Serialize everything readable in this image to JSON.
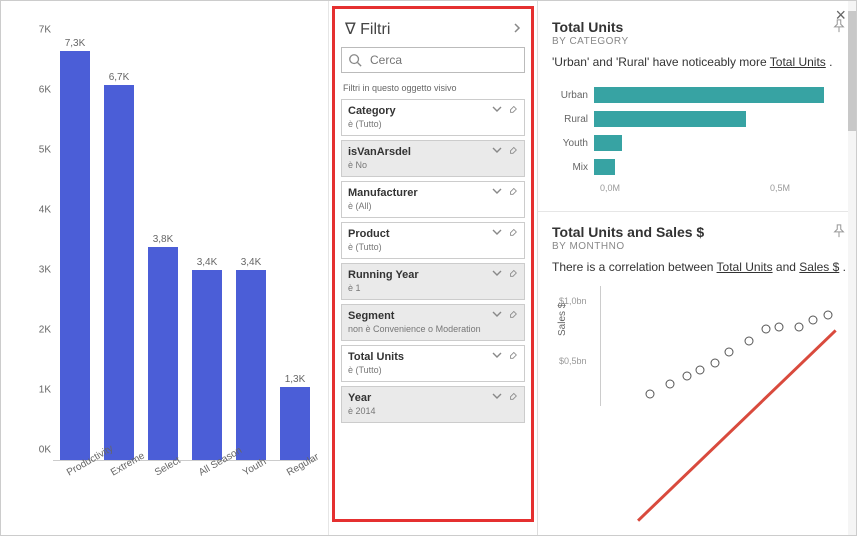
{
  "filters": {
    "header": "Filtri",
    "search_placeholder": "Cerca",
    "section_title": "Filtri in questo oggetto visivo",
    "cards": [
      {
        "name": "Category",
        "desc": "è (Tutto)",
        "active": false
      },
      {
        "name": "isVanArsdel",
        "desc": "è No",
        "active": true
      },
      {
        "name": "Manufacturer",
        "desc": "è (All)",
        "active": false
      },
      {
        "name": "Product",
        "desc": "è (Tutto)",
        "active": false
      },
      {
        "name": "Running Year",
        "desc": "è 1",
        "active": true
      },
      {
        "name": "Segment",
        "desc": "non è Convenience o Moderation",
        "active": true
      },
      {
        "name": "Total Units",
        "desc": "è (Tutto)",
        "active": false
      },
      {
        "name": "Year",
        "desc": "è 2014",
        "active": true
      }
    ]
  },
  "chart_data": [
    {
      "type": "bar",
      "orientation": "vertical",
      "title": "",
      "ylabel": "",
      "ylim": [
        0,
        7500
      ],
      "y_ticks": [
        "0K",
        "1K",
        "2K",
        "3K",
        "4K",
        "5K",
        "6K",
        "7K"
      ],
      "categories": [
        "Productivity",
        "Extreme",
        "Select",
        "All Season",
        "Youth",
        "Regular"
      ],
      "values": [
        7300,
        6700,
        3800,
        3400,
        3400,
        1300
      ],
      "value_labels": [
        "7,3K",
        "6,7K",
        "3,8K",
        "3,4K",
        "3,4K",
        "1,3K"
      ],
      "bar_color": "#4b5ed7"
    },
    {
      "type": "bar",
      "orientation": "horizontal",
      "title": "Total Units",
      "subtitle": "BY CATEGORY",
      "description": "'Urban' and 'Rural' have noticeably more Total Units .",
      "categories": [
        "Urban",
        "Rural",
        "Youth",
        "Mix"
      ],
      "values": [
        500000,
        330000,
        60000,
        45000
      ],
      "x_ticks": [
        "0,0M",
        "0,5M"
      ],
      "bar_color": "#37a3a3"
    },
    {
      "type": "scatter",
      "title": "Total Units and Sales $",
      "subtitle": "BY MONTHNO",
      "description_parts": [
        "There is a correlation between ",
        "Total Units",
        " and ",
        "Sales $"
      ],
      "ylabel": "Sales $",
      "y_ticks": [
        "$1,0bn",
        "$0,5bn"
      ],
      "points": [
        {
          "x": 0.2,
          "y": 0.9
        },
        {
          "x": 0.28,
          "y": 0.82
        },
        {
          "x": 0.35,
          "y": 0.75
        },
        {
          "x": 0.4,
          "y": 0.7
        },
        {
          "x": 0.46,
          "y": 0.64
        },
        {
          "x": 0.52,
          "y": 0.55
        },
        {
          "x": 0.6,
          "y": 0.46
        },
        {
          "x": 0.67,
          "y": 0.36
        },
        {
          "x": 0.72,
          "y": 0.34
        },
        {
          "x": 0.8,
          "y": 0.34
        },
        {
          "x": 0.86,
          "y": 0.28
        },
        {
          "x": 0.92,
          "y": 0.24
        }
      ],
      "trend_color": "#d94a3d"
    }
  ]
}
